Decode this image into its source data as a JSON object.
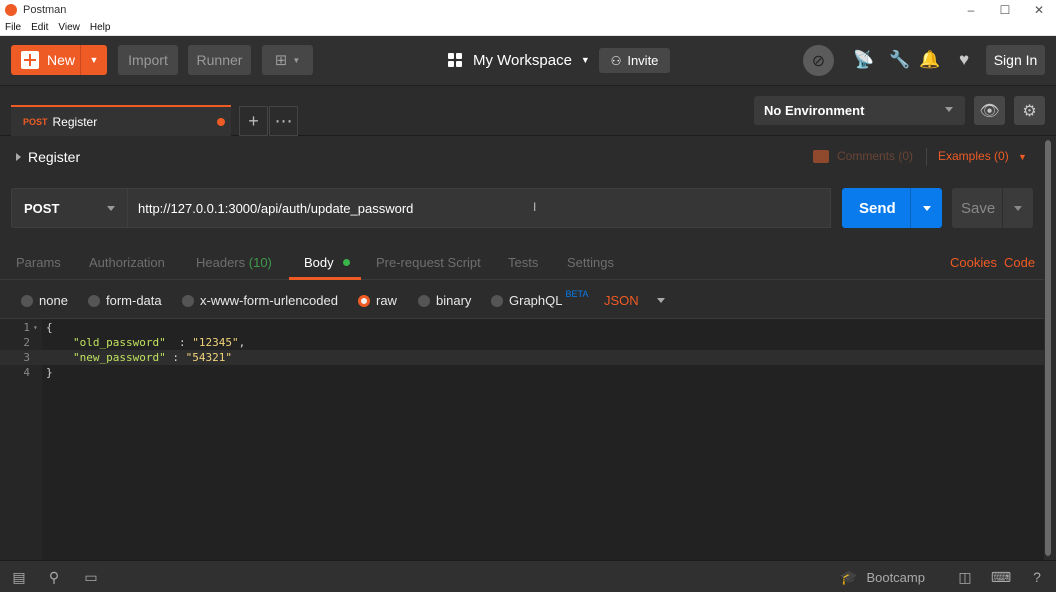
{
  "window": {
    "title": "Postman"
  },
  "menu": [
    "File",
    "Edit",
    "View",
    "Help"
  ],
  "header": {
    "new_label": "New",
    "import_label": "Import",
    "runner_label": "Runner",
    "workspace": "My Workspace",
    "invite_label": "Invite",
    "signin_label": "Sign In"
  },
  "tab": {
    "method": "POST",
    "name": "Register"
  },
  "environment": {
    "selected": "No Environment"
  },
  "request": {
    "name": "Register",
    "comments": "Comments (0)",
    "examples": "Examples (0)",
    "method": "POST",
    "url": "http://127.0.0.1:3000/api/auth/update_password",
    "send_label": "Send",
    "save_label": "Save"
  },
  "subtabs": {
    "params": "Params",
    "authorization": "Authorization",
    "headers": "Headers",
    "headers_count": "(10)",
    "body": "Body",
    "prerequest": "Pre-request Script",
    "tests": "Tests",
    "settings": "Settings",
    "cookies": "Cookies",
    "code": "Code"
  },
  "body_options": {
    "none": "none",
    "form_data": "form-data",
    "urlencoded": "x-www-form-urlencoded",
    "raw": "raw",
    "binary": "binary",
    "graphql": "GraphQL",
    "beta": "BETA",
    "format": "JSON",
    "selected": "raw"
  },
  "editor": {
    "lines": [
      {
        "n": "1",
        "open": "{"
      },
      {
        "n": "2",
        "key": "\"old_password\"",
        "sep": "  : ",
        "val": "\"12345\"",
        "tail": ","
      },
      {
        "n": "3",
        "key": "\"new_password\"",
        "sep": " : ",
        "val": "\"54321\"",
        "tail": ""
      },
      {
        "n": "4",
        "open": "}"
      }
    ]
  },
  "footer": {
    "bootcamp_label": "Bootcamp"
  },
  "colors": {
    "accent": "#ef5b25",
    "send": "#097bed",
    "status_green": "#3ab54a"
  }
}
